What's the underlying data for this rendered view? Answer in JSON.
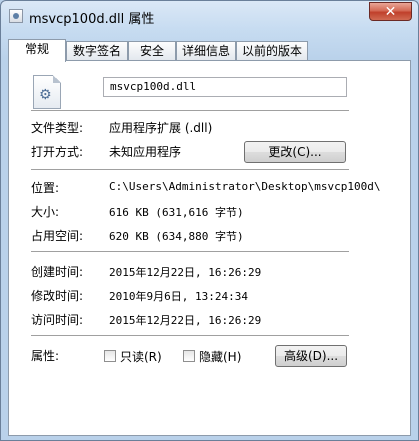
{
  "window": {
    "title": "msvcp100d.dll 属性",
    "close_glyph": "✕"
  },
  "tabs": [
    {
      "label": "常规",
      "active": true
    },
    {
      "label": "数字签名",
      "active": false
    },
    {
      "label": "安全",
      "active": false
    },
    {
      "label": "详细信息",
      "active": false
    },
    {
      "label": "以前的版本",
      "active": false
    }
  ],
  "general": {
    "file_name": "msvcp100d.dll",
    "file_icon": "settings-file-icon",
    "type_label": "文件类型:",
    "type_value": "应用程序扩展 (.dll)",
    "open_with_label": "打开方式:",
    "open_with_value": "未知应用程序",
    "change_button": "更改(C)...",
    "location_label": "位置:",
    "location_value": "C:\\Users\\Administrator\\Desktop\\msvcp100d\\",
    "size_label": "大小:",
    "size_value": "616 KB (631,616 字节)",
    "disk_size_label": "占用空间:",
    "disk_size_value": "620 KB (634,880 字节)",
    "created_label": "创建时间:",
    "created_value": "2015年12月22日, 16:26:29",
    "modified_label": "修改时间:",
    "modified_value": "2010年9月6日, 13:24:34",
    "accessed_label": "访问时间:",
    "accessed_value": "2015年12月22日, 16:26:29",
    "attributes_label": "属性:",
    "readonly_label": "只读(R)",
    "readonly_checked": false,
    "hidden_label": "隐藏(H)",
    "hidden_checked": false,
    "advanced_button": "高级(D)..."
  }
}
